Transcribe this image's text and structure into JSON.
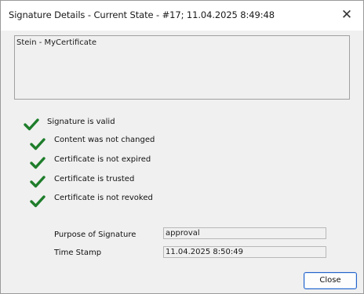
{
  "window": {
    "title": "Signature Details - Current State - #17;  11.04.2025  8:49:48",
    "close_glyph": "✕"
  },
  "signer": {
    "text": "Stein  - MyCertificate"
  },
  "status": {
    "summary": "Signature is valid",
    "checks": [
      "Content was not changed",
      "Certificate is not expired",
      "Certificate is trusted",
      "Certificate is not revoked"
    ],
    "check_color": "#1e7d2b"
  },
  "details": {
    "purpose_label": "Purpose of Signature",
    "purpose_value": "approval",
    "timestamp_label": "Time Stamp",
    "timestamp_value": "11.04.2025 8:50:49"
  },
  "buttons": {
    "close_label": "Close"
  }
}
